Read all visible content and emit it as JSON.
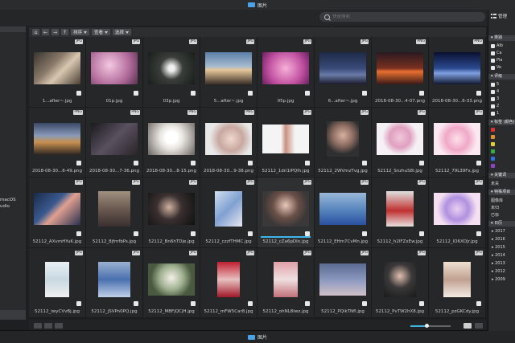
{
  "window": {
    "title": "图片"
  },
  "search": {
    "placeholder": "快速搜索"
  },
  "left_panel": {
    "items": [
      "macOS",
      "udio"
    ]
  },
  "toolbar": {
    "sort_label": "排序",
    "view_label": "查看",
    "select_label": "选择"
  },
  "grid": [
    {
      "name": "1...after~.jpg",
      "badge": "JPG",
      "thumb": "linear-gradient(135deg,#3a3530,#8a7a6a 40%,#d8c8b0 60%,#4a3e34)",
      "w": 58,
      "h": 40
    },
    {
      "name": "01p.jpg",
      "badge": "JPG",
      "thumb": "radial-gradient(circle at 40% 40%,#f4c8e0,#b06a9a 60%,#5a3050)",
      "w": 58,
      "h": 40
    },
    {
      "name": "03p.jpg",
      "badge": "JPG",
      "thumb": "radial-gradient(circle at 50% 50%,#f0f0f0 10%,#3a3e3a 40%,#1a1e1a)",
      "w": 58,
      "h": 40
    },
    {
      "name": "5...after~.jpg",
      "badge": "JPG",
      "thumb": "linear-gradient(180deg,#5a7fa8,#a8bcd0 45%,#e8c89a 55%,#3a3028)",
      "w": 58,
      "h": 40
    },
    {
      "name": "05p.jpg",
      "badge": "JPG",
      "thumb": "radial-gradient(circle at 50% 50%,#f8b0d8,#c050a0 60%,#6a2060)",
      "w": 58,
      "h": 40
    },
    {
      "name": "6...after~.jpg",
      "badge": "JPG",
      "thumb": "linear-gradient(180deg,#1e2a48,#3a4a78 50%,#6a7aa8 70%,#1a1a2a)",
      "w": 58,
      "h": 40
    },
    {
      "name": "2018-08-30...4-07.png",
      "badge": "PNG",
      "thumb": "linear-gradient(180deg,#2a1a20,#7a3020 50%,#e87030 60%,#3a1a18)",
      "w": 58,
      "h": 40
    },
    {
      "name": "2018-08-30...6-33.png",
      "badge": "PNG",
      "thumb": "linear-gradient(180deg,#0a1030,#2a4a90 50%,#80a0e0 65%,#101830)",
      "w": 58,
      "h": 40
    },
    {
      "name": "2018-08-30...6-49.png",
      "badge": "PNG",
      "thumb": "linear-gradient(180deg,#3a4868,#8a9ab8 40%,#c89050 60%,#2a2420)",
      "w": 58,
      "h": 40
    },
    {
      "name": "2018-08-30...7-36.png",
      "badge": "PNG",
      "thumb": "linear-gradient(135deg,#1a1a1e,#5a5060 50%,#2a2428)",
      "w": 58,
      "h": 40
    },
    {
      "name": "2018-08-30...8-15.png",
      "badge": "PNG",
      "thumb": "radial-gradient(circle at 50% 45%,#ffffff 20%,#e8e4e0 40%,#6a6460)",
      "w": 58,
      "h": 40
    },
    {
      "name": "2018-08-30...9-38.png",
      "badge": "PNG",
      "thumb": "radial-gradient(circle at 55% 50%,#f0d8d0,#c8a8a0 40%,#e8e8e8 70%)",
      "w": 58,
      "h": 40
    },
    {
      "name": "52112_1dri1IPQlh.jpg",
      "badge": "JPG",
      "thumb": "linear-gradient(90deg,#f4f4f4 40%,#c89080 50%,#f4f4f4 70%)",
      "w": 58,
      "h": 36
    },
    {
      "name": "52112_2WVmzTvg.jpg",
      "badge": "JPG",
      "thumb": "radial-gradient(circle at 50% 40%,#d8b0a0,#8a6a60 40%,#303030 70%)",
      "w": 40,
      "h": 44
    },
    {
      "name": "52112_SnzhuS8l.jpg",
      "badge": "JPG",
      "thumb": "radial-gradient(circle at 50% 45%,#f0c8d8,#e0a0c0 35%,#f4f0f4 60%)",
      "w": 58,
      "h": 40
    },
    {
      "name": "52112_79L39Fx.jpg",
      "badge": "JPG",
      "thumb": "radial-gradient(circle at 50% 50%,#fce0e8,#f0a8c8 40%,#fbe8f0 70%)",
      "w": 58,
      "h": 40
    },
    {
      "name": "52112_AXvmHYuK.jpg",
      "badge": "JPG",
      "thumb": "linear-gradient(135deg,#1a2a48,#3a5a90 40%,#e0a090 55%,#2a3050)",
      "w": 58,
      "h": 40
    },
    {
      "name": "52112_8jfmfbPs.jpg",
      "badge": "JPG",
      "thumb": "linear-gradient(180deg,#a09080,#6a5a50 50%,#3a3030)",
      "w": 40,
      "h": 44
    },
    {
      "name": "52112_Bn6hTDje.jpg",
      "badge": "JPG",
      "thumb": "radial-gradient(circle at 45% 45%,#d0b0a0,#3a3030 40%,#101010)",
      "w": 58,
      "h": 40
    },
    {
      "name": "52112_czzfTHMC.jpg",
      "badge": "JPG",
      "thumb": "linear-gradient(135deg,#d0e0f0,#80a0d0 50%,#e8e8f0)",
      "w": 34,
      "h": 44
    },
    {
      "name": "52112_cZa6pDln.jpg",
      "badge": "JPG",
      "thumb": "radial-gradient(circle at 50% 40%,#e8c8b8,#6a5048 40%,#3a3838 70%)",
      "w": 58,
      "h": 44,
      "selected": true
    },
    {
      "name": "52112_EHm7CvMn.jpg",
      "badge": "JPG",
      "thumb": "linear-gradient(180deg,#9ab8d8,#5a88c0 50%,#2a50a0)",
      "w": 58,
      "h": 40
    },
    {
      "name": "52112_h2lFZxEw.jpg",
      "badge": "JPG",
      "thumb": "linear-gradient(180deg,#e0e0e0,#c03030 55%,#e8e0e0)",
      "w": 34,
      "h": 44
    },
    {
      "name": "52112_lO6XDJr.jpg",
      "badge": "JPG",
      "thumb": "radial-gradient(circle at 50% 50%,#e8d0f0,#b090e0 40%,#f4e0f0 70%)",
      "w": 58,
      "h": 40
    },
    {
      "name": "52112_iwyCVvBj.jpg",
      "badge": "JPG",
      "thumb": "linear-gradient(180deg,#e8f0f4,#c8d8e0 50%,#f0f0f0)",
      "w": 30,
      "h": 44
    },
    {
      "name": "52112_jSVPn0PQ.jpg",
      "badge": "JPG",
      "thumb": "linear-gradient(180deg,#9ab0d0,#4a70b0 50%,#c0d0e8)",
      "w": 40,
      "h": 44
    },
    {
      "name": "52112_MBFjQCjH.jpg",
      "badge": "JPG",
      "thumb": "radial-gradient(circle at 50% 45%,#f4f0e8,#a0b090 40%,#4a5a40 70%)",
      "w": 58,
      "h": 40
    },
    {
      "name": "52112_mFW5Car8.jpg",
      "badge": "JPG",
      "thumb": "linear-gradient(180deg,#c02030,#e8c0c0 50%,#a01828)",
      "w": 28,
      "h": 44
    },
    {
      "name": "52112_ohNL8iwz.jpg",
      "badge": "JPG",
      "thumb": "linear-gradient(180deg,#e0a0a8,#f0e0e0 50%,#c07078)",
      "w": 30,
      "h": 44
    },
    {
      "name": "52112_PQikTNfl.jpg",
      "badge": "JPG",
      "thumb": "linear-gradient(180deg,#5a6a90,#8a98c0 50%,#d0c0c8)",
      "w": 58,
      "h": 40
    },
    {
      "name": "52112_PvTW2hX8.jpg",
      "badge": "JPG",
      "thumb": "radial-gradient(circle at 50% 40%,#e0c0b0,#3a3838 45%,#1a1a1a)",
      "w": 40,
      "h": 44
    },
    {
      "name": "52112_pzGKCdy.jpg",
      "badge": "JPG",
      "thumb": "linear-gradient(180deg,#f0e0d0,#c0a090 50%,#f4ece4)",
      "w": 34,
      "h": 44
    }
  ],
  "footer": {
    "title": "图片"
  },
  "zoom_level": 0.4,
  "right_panel": {
    "manage_label": "管理",
    "sections": [
      {
        "title": "类别",
        "rows": [
          "Alb",
          "Ca",
          "Pla",
          "Ve"
        ],
        "kind": "cb"
      },
      {
        "title": "评级",
        "rows": [
          "5",
          "4",
          "3",
          "2",
          "1"
        ],
        "kind": "cb"
      },
      {
        "title": "标签 (颜色)",
        "rows": [
          "",
          "",
          "",
          "",
          "",
          ""
        ],
        "kind": "color",
        "colors": [
          "#e03030",
          "#e09030",
          "#e0d030",
          "#30b040",
          "#3070e0",
          "#9040c0"
        ]
      },
      {
        "title": "关键词",
        "rows": [
          "未关"
        ],
        "kind": "text"
      },
      {
        "title": "特殊项目",
        "rows": [
          "图像库",
          "未归",
          "已标"
        ],
        "kind": "text"
      },
      {
        "title": "日历",
        "rows": [
          "2017",
          "2016",
          "2015",
          "2014",
          "2013",
          "2012",
          "2009"
        ],
        "kind": "year"
      }
    ]
  }
}
